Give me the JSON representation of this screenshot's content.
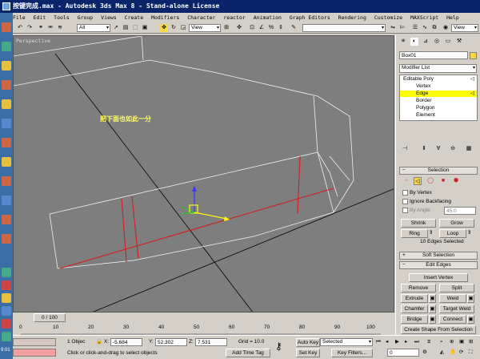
{
  "title": "按键完成.max - Autodesk 3ds Max 8 - Stand-alone License",
  "menu": [
    "File",
    "Edit",
    "Tools",
    "Group",
    "Views",
    "Create",
    "Modifiers",
    "Character",
    "reactor",
    "Animation",
    "Graph Editors",
    "Rendering",
    "Customize",
    "MAXScript",
    "Help"
  ],
  "toolbar": {
    "selection_filter": "All",
    "ref_coord": "View",
    "named_sel": "",
    "view_right": "View"
  },
  "viewport": {
    "label": "Perspective",
    "annotation": "把下面也如此一分"
  },
  "command_panel": {
    "object_name": "Box01",
    "modifier_list": "Modifier List",
    "stack": {
      "root": "Editable Poly",
      "items": [
        "Vertex",
        "Edge",
        "Border",
        "Polygon",
        "Element"
      ],
      "selected": "Edge"
    },
    "selection": {
      "header": "Selection",
      "by_vertex": "By Vertex",
      "ignore_backfacing": "Ignore Backfacing",
      "by_angle": "By Angle:",
      "angle_value": "45.0",
      "shrink": "Shrink",
      "grow": "Grow",
      "ring": "Ring",
      "loop": "Loop",
      "status": "10 Edges Selected"
    },
    "soft_selection": {
      "header": "Soft Selection"
    },
    "edit_edges": {
      "header": "Edit Edges",
      "insert_vertex": "Insert Vertex",
      "remove": "Remove",
      "split": "Split",
      "extrude": "Extrude",
      "weld": "Weld",
      "chamfer": "Chamfer",
      "target_weld": "Target Weld",
      "bridge": "Bridge",
      "connect": "Connect",
      "create_shape": "Create Shape From Selection"
    }
  },
  "timeline": {
    "frame": "0 / 100",
    "ticks": [
      "0",
      "10",
      "20",
      "30",
      "40",
      "50",
      "60",
      "70",
      "80",
      "90",
      "100"
    ]
  },
  "status": {
    "objects": "1 Objec",
    "x_label": "X:",
    "x": "-5.684",
    "y_label": "Y:",
    "y": "52.302",
    "z_label": "Z:",
    "z": "7.531",
    "grid": "Grid = 10.0",
    "prompt": "Click or click-and-drag to select objects",
    "add_time_tag": "Add Time Tag",
    "auto_key": "Auto Key",
    "set_key": "Set Key",
    "key_mode": "Selected",
    "key_filters": "Key Filters...",
    "frame_field": "0",
    "clock": "9:01"
  },
  "colors": {
    "accent": "#0a246a",
    "selected": "#ffff00",
    "viewport": "#7e7e7e",
    "edge_sel": "#cc2222"
  }
}
